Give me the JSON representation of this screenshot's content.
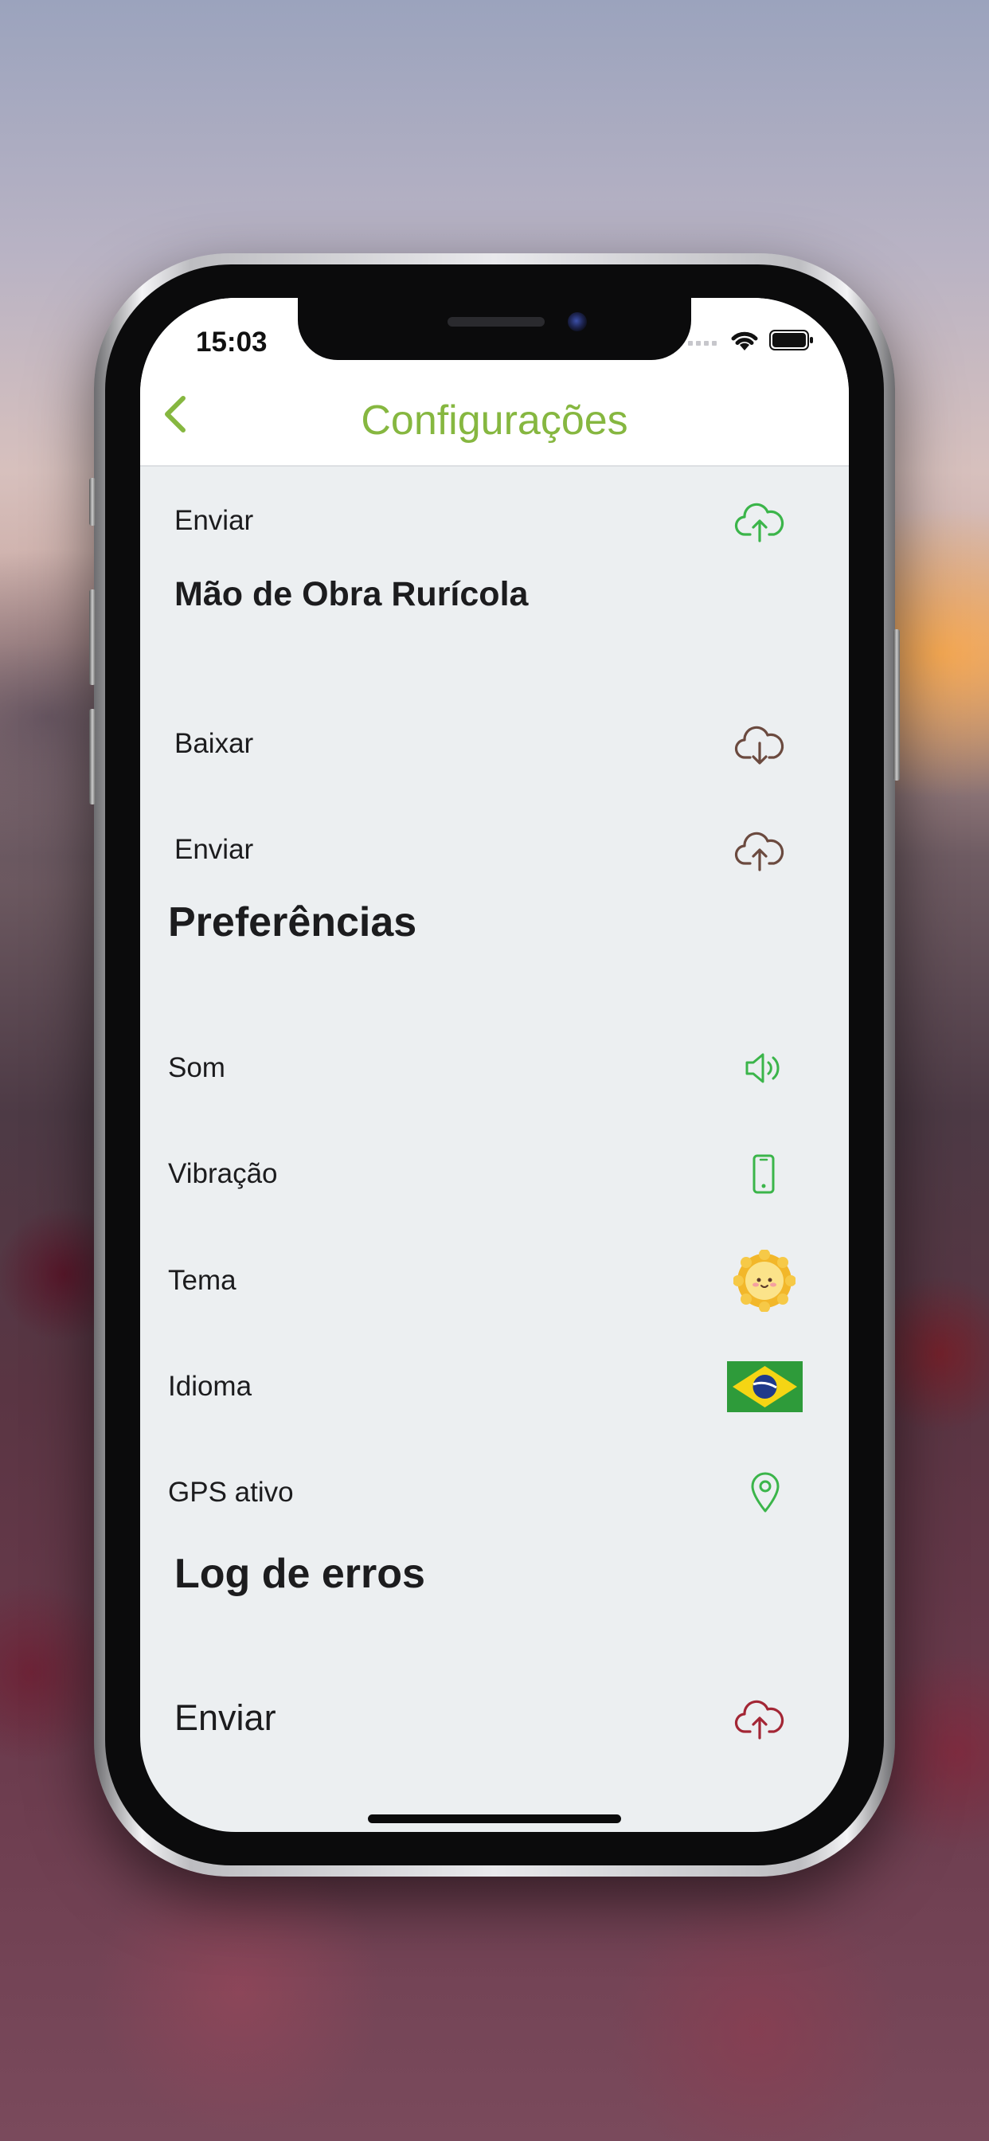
{
  "status_bar": {
    "time": "15:03"
  },
  "nav": {
    "title": "Configurações",
    "back_icon": "chevron-left-icon"
  },
  "colors": {
    "accent_green": "#86b740",
    "icon_green": "#3bb54a",
    "icon_brown": "#6b4a3f",
    "icon_red": "#a32635",
    "background": "#eceff1"
  },
  "sections": {
    "top_send": {
      "label": "Enviar",
      "icon": "cloud-upload-icon"
    },
    "labor": {
      "title": "Mão de Obra Rurícola",
      "items": [
        {
          "label": "Baixar",
          "icon": "cloud-download-icon"
        },
        {
          "label": "Enviar",
          "icon": "cloud-upload-icon"
        }
      ]
    },
    "preferences": {
      "title": "Preferências",
      "items": [
        {
          "label": "Som",
          "icon": "speaker-icon"
        },
        {
          "label": "Vibração",
          "icon": "phone-vibrate-icon"
        },
        {
          "label": "Tema",
          "icon": "sun-icon"
        },
        {
          "label": "Idioma",
          "icon": "brazil-flag-icon"
        },
        {
          "label": "GPS ativo",
          "icon": "location-pin-icon"
        }
      ]
    },
    "error_log": {
      "title": "Log de erros",
      "items": [
        {
          "label": "Enviar",
          "icon": "cloud-upload-icon"
        }
      ]
    }
  }
}
